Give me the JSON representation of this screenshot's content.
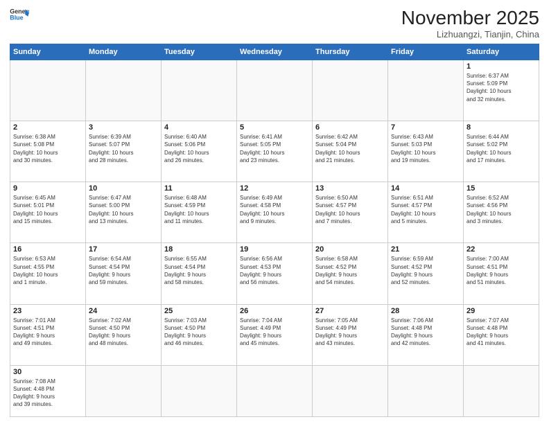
{
  "header": {
    "logo_line1": "General",
    "logo_line2": "Blue",
    "month_title": "November 2025",
    "location": "Lizhuangzi, Tianjin, China"
  },
  "weekdays": [
    "Sunday",
    "Monday",
    "Tuesday",
    "Wednesday",
    "Thursday",
    "Friday",
    "Saturday"
  ],
  "weeks": [
    [
      {
        "day": "",
        "info": ""
      },
      {
        "day": "",
        "info": ""
      },
      {
        "day": "",
        "info": ""
      },
      {
        "day": "",
        "info": ""
      },
      {
        "day": "",
        "info": ""
      },
      {
        "day": "",
        "info": ""
      },
      {
        "day": "1",
        "info": "Sunrise: 6:37 AM\nSunset: 5:09 PM\nDaylight: 10 hours\nand 32 minutes."
      }
    ],
    [
      {
        "day": "2",
        "info": "Sunrise: 6:38 AM\nSunset: 5:08 PM\nDaylight: 10 hours\nand 30 minutes."
      },
      {
        "day": "3",
        "info": "Sunrise: 6:39 AM\nSunset: 5:07 PM\nDaylight: 10 hours\nand 28 minutes."
      },
      {
        "day": "4",
        "info": "Sunrise: 6:40 AM\nSunset: 5:06 PM\nDaylight: 10 hours\nand 26 minutes."
      },
      {
        "day": "5",
        "info": "Sunrise: 6:41 AM\nSunset: 5:05 PM\nDaylight: 10 hours\nand 23 minutes."
      },
      {
        "day": "6",
        "info": "Sunrise: 6:42 AM\nSunset: 5:04 PM\nDaylight: 10 hours\nand 21 minutes."
      },
      {
        "day": "7",
        "info": "Sunrise: 6:43 AM\nSunset: 5:03 PM\nDaylight: 10 hours\nand 19 minutes."
      },
      {
        "day": "8",
        "info": "Sunrise: 6:44 AM\nSunset: 5:02 PM\nDaylight: 10 hours\nand 17 minutes."
      }
    ],
    [
      {
        "day": "9",
        "info": "Sunrise: 6:45 AM\nSunset: 5:01 PM\nDaylight: 10 hours\nand 15 minutes."
      },
      {
        "day": "10",
        "info": "Sunrise: 6:47 AM\nSunset: 5:00 PM\nDaylight: 10 hours\nand 13 minutes."
      },
      {
        "day": "11",
        "info": "Sunrise: 6:48 AM\nSunset: 4:59 PM\nDaylight: 10 hours\nand 11 minutes."
      },
      {
        "day": "12",
        "info": "Sunrise: 6:49 AM\nSunset: 4:58 PM\nDaylight: 10 hours\nand 9 minutes."
      },
      {
        "day": "13",
        "info": "Sunrise: 6:50 AM\nSunset: 4:57 PM\nDaylight: 10 hours\nand 7 minutes."
      },
      {
        "day": "14",
        "info": "Sunrise: 6:51 AM\nSunset: 4:57 PM\nDaylight: 10 hours\nand 5 minutes."
      },
      {
        "day": "15",
        "info": "Sunrise: 6:52 AM\nSunset: 4:56 PM\nDaylight: 10 hours\nand 3 minutes."
      }
    ],
    [
      {
        "day": "16",
        "info": "Sunrise: 6:53 AM\nSunset: 4:55 PM\nDaylight: 10 hours\nand 1 minute."
      },
      {
        "day": "17",
        "info": "Sunrise: 6:54 AM\nSunset: 4:54 PM\nDaylight: 9 hours\nand 59 minutes."
      },
      {
        "day": "18",
        "info": "Sunrise: 6:55 AM\nSunset: 4:54 PM\nDaylight: 9 hours\nand 58 minutes."
      },
      {
        "day": "19",
        "info": "Sunrise: 6:56 AM\nSunset: 4:53 PM\nDaylight: 9 hours\nand 56 minutes."
      },
      {
        "day": "20",
        "info": "Sunrise: 6:58 AM\nSunset: 4:52 PM\nDaylight: 9 hours\nand 54 minutes."
      },
      {
        "day": "21",
        "info": "Sunrise: 6:59 AM\nSunset: 4:52 PM\nDaylight: 9 hours\nand 52 minutes."
      },
      {
        "day": "22",
        "info": "Sunrise: 7:00 AM\nSunset: 4:51 PM\nDaylight: 9 hours\nand 51 minutes."
      }
    ],
    [
      {
        "day": "23",
        "info": "Sunrise: 7:01 AM\nSunset: 4:51 PM\nDaylight: 9 hours\nand 49 minutes."
      },
      {
        "day": "24",
        "info": "Sunrise: 7:02 AM\nSunset: 4:50 PM\nDaylight: 9 hours\nand 48 minutes."
      },
      {
        "day": "25",
        "info": "Sunrise: 7:03 AM\nSunset: 4:50 PM\nDaylight: 9 hours\nand 46 minutes."
      },
      {
        "day": "26",
        "info": "Sunrise: 7:04 AM\nSunset: 4:49 PM\nDaylight: 9 hours\nand 45 minutes."
      },
      {
        "day": "27",
        "info": "Sunrise: 7:05 AM\nSunset: 4:49 PM\nDaylight: 9 hours\nand 43 minutes."
      },
      {
        "day": "28",
        "info": "Sunrise: 7:06 AM\nSunset: 4:48 PM\nDaylight: 9 hours\nand 42 minutes."
      },
      {
        "day": "29",
        "info": "Sunrise: 7:07 AM\nSunset: 4:48 PM\nDaylight: 9 hours\nand 41 minutes."
      }
    ],
    [
      {
        "day": "30",
        "info": "Sunrise: 7:08 AM\nSunset: 4:48 PM\nDaylight: 9 hours\nand 39 minutes."
      },
      {
        "day": "",
        "info": ""
      },
      {
        "day": "",
        "info": ""
      },
      {
        "day": "",
        "info": ""
      },
      {
        "day": "",
        "info": ""
      },
      {
        "day": "",
        "info": ""
      },
      {
        "day": "",
        "info": ""
      }
    ]
  ]
}
